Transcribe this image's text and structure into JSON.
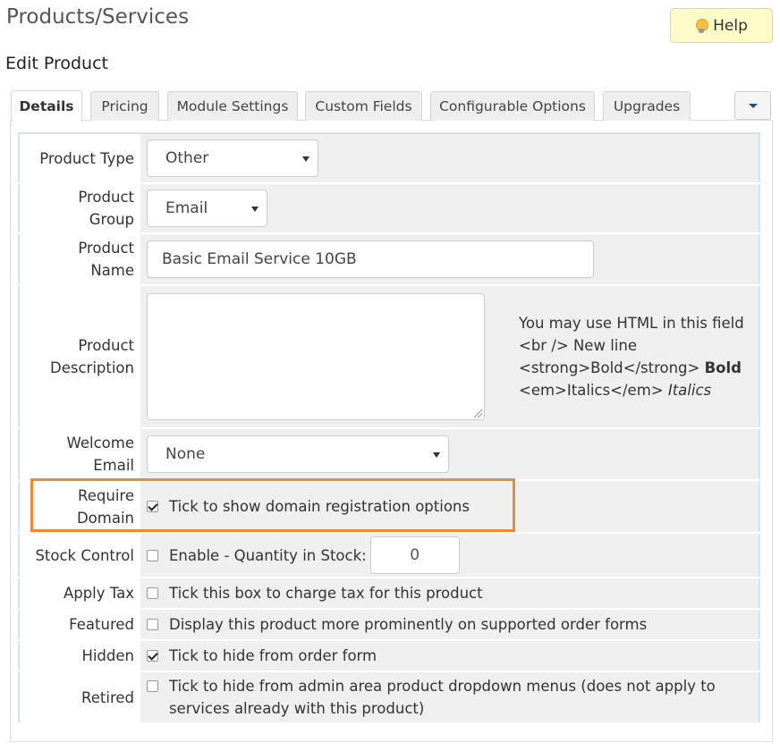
{
  "page": {
    "title": "Products/Services",
    "help_label": "Help",
    "subtitle": "Edit Product"
  },
  "tabs": [
    {
      "label": "Details",
      "active": true
    },
    {
      "label": "Pricing",
      "active": false
    },
    {
      "label": "Module Settings",
      "active": false
    },
    {
      "label": "Custom Fields",
      "active": false
    },
    {
      "label": "Configurable Options",
      "active": false
    },
    {
      "label": "Upgrades",
      "active": false
    }
  ],
  "form": {
    "product_type": {
      "label": "Product Type",
      "value": "Other"
    },
    "product_group": {
      "label_1": "Product",
      "label_2": "Group",
      "value": "Email"
    },
    "product_name": {
      "label_1": "Product",
      "label_2": "Name",
      "value": "Basic Email Service 10GB"
    },
    "description": {
      "label_1": "Product",
      "label_2": "Description",
      "value": "",
      "help_1": "You may use HTML in this field",
      "help_2": "<br /> New line",
      "help_3_code": "<strong>Bold</strong>",
      "help_3_example": "Bold",
      "help_4_code": "<em>Italics</em>",
      "help_4_example": "Italics"
    },
    "welcome_email": {
      "label_1": "Welcome",
      "label_2": "Email",
      "value": "None"
    },
    "require_domain": {
      "label_1": "Require",
      "label_2": "Domain",
      "checked": true,
      "text": "Tick to show domain registration options"
    },
    "stock_control": {
      "label": "Stock Control",
      "checked": false,
      "text": "Enable - Quantity in Stock:",
      "quantity": "0"
    },
    "apply_tax": {
      "label": "Apply Tax",
      "checked": false,
      "text": "Tick this box to charge tax for this product"
    },
    "featured": {
      "label": "Featured",
      "checked": false,
      "text": "Display this product more prominently on supported order forms"
    },
    "hidden": {
      "label": "Hidden",
      "checked": true,
      "text": "Tick to hide from order form"
    },
    "retired": {
      "label": "Retired",
      "checked": false,
      "text_1": "Tick to hide from admin area product dropdown menus (does not apply to",
      "text_2": "services already with this product)"
    }
  },
  "colors": {
    "highlight_border": "#ef8a2d",
    "help_button_bg": "#fdfcc8",
    "field_cell_bg": "#efefef"
  },
  "icons": {
    "help": "lightbulb-icon",
    "tab_menu": "caret-down-icon"
  }
}
